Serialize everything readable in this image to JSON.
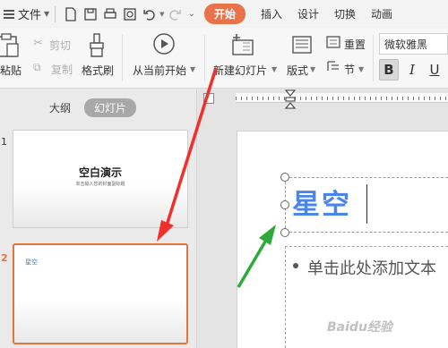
{
  "menubar": {
    "file_label": "文件",
    "tabs": [
      "开始",
      "插入",
      "设计",
      "切换",
      "动画"
    ]
  },
  "ribbon": {
    "paste_label": "粘贴",
    "cut_label": "剪切",
    "copy_label": "复制",
    "format_painter_label": "格式刷",
    "from_current_label": "从当前开始",
    "new_slide_label": "新建幻灯片",
    "layout_label": "版式",
    "reset_label": "重置",
    "section_label": "节",
    "font_name": "微软雅黑",
    "bold_label": "B",
    "italic_label": "I",
    "underline_label": "U"
  },
  "left_panel": {
    "tab_outline": "大纲",
    "tab_slides": "幻灯片",
    "slides": [
      {
        "number": "1",
        "title": "空白演示",
        "subtitle": "单击输入您的封面副标题"
      },
      {
        "number": "2",
        "title": "星空"
      }
    ]
  },
  "slide": {
    "title_text": "星空",
    "body_placeholder": "单击此处添加文本"
  },
  "watermark": "Baidu经验",
  "colors": {
    "accent": "#e8734b",
    "title_blue": "#4a86e8",
    "arrow_red": "#f0302a",
    "arrow_green": "#2eaa3a"
  }
}
